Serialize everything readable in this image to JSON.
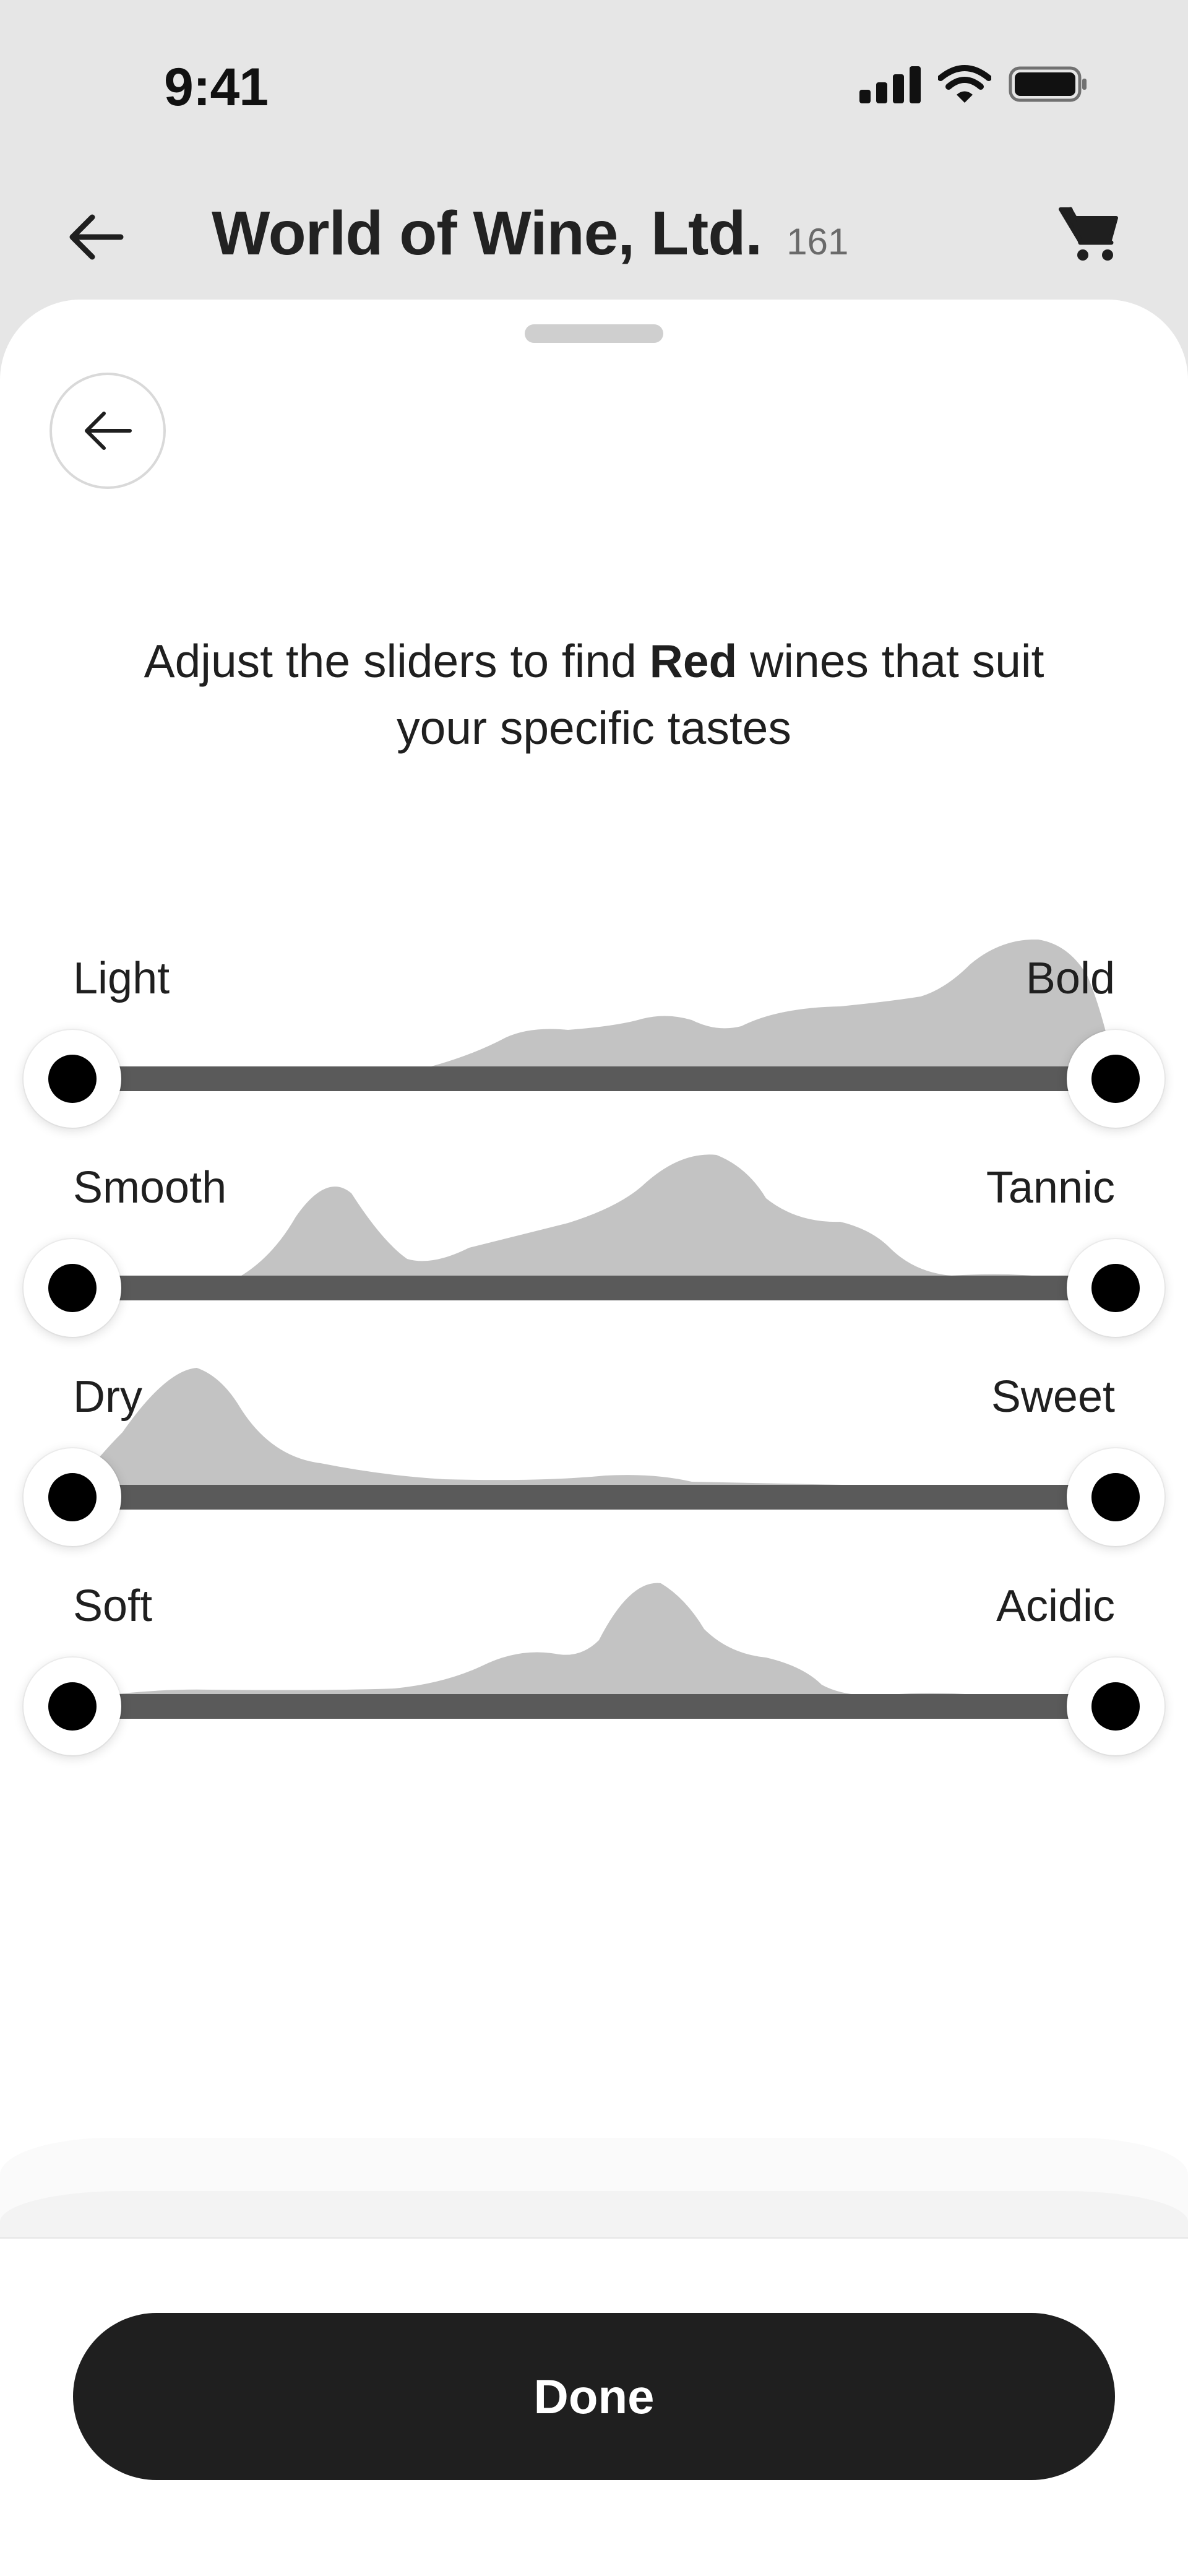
{
  "status_bar": {
    "time": "9:41",
    "icons": [
      "signal-icon",
      "wifi-icon",
      "battery-icon"
    ]
  },
  "nav": {
    "back_icon": "arrow-left-icon",
    "title": "World of Wine, Ltd.",
    "count": "161",
    "cart_icon": "cart-icon"
  },
  "sheet": {
    "back_icon": "arrow-left-icon",
    "instruction": {
      "prefix": "Adjust the sliders to find ",
      "highlight": "Red",
      "suffix": " wines that suit your specific tastes"
    },
    "sliders": [
      {
        "left_label": "Light",
        "right_label": "Bold",
        "min_value": 0,
        "max_value": 1
      },
      {
        "left_label": "Smooth",
        "right_label": "Tannic",
        "min_value": 0,
        "max_value": 1
      },
      {
        "left_label": "Dry",
        "right_label": "Sweet",
        "min_value": 0,
        "max_value": 1
      },
      {
        "left_label": "Soft",
        "right_label": "Acidic",
        "min_value": 0,
        "max_value": 1
      }
    ]
  },
  "footer": {
    "done_label": "Done"
  },
  "colors": {
    "background": "#e6e6e6",
    "sheet": "#ffffff",
    "track": "#5a5a5a",
    "distribution": "#c3c3c3",
    "button": "#1f1f1f",
    "handle_dot": "#000000"
  }
}
